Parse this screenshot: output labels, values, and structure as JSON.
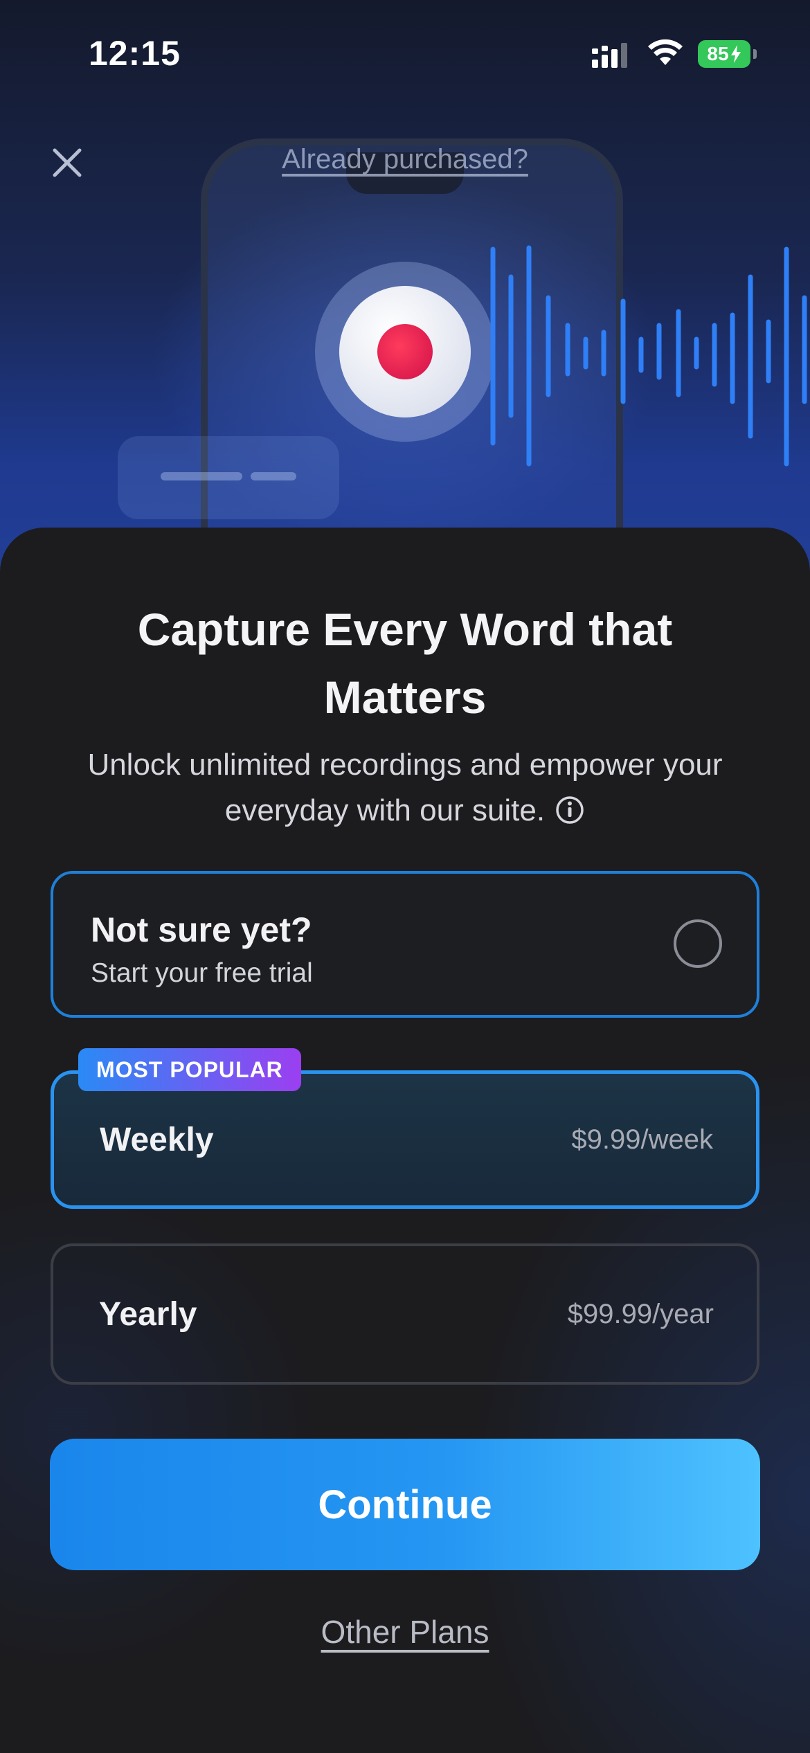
{
  "status_bar": {
    "time": "12:15",
    "battery": "85"
  },
  "header": {
    "already_purchased_label": "Already purchased?"
  },
  "headline": "Capture Every Word that Matters",
  "subtitle": "Unlock unlimited recordings and empower your everyday with our suite.",
  "plans": [
    {
      "title": "Not sure yet?",
      "subtitle": "Start your free trial",
      "selected": false
    },
    {
      "badge": "MOST POPULAR",
      "name": "Weekly",
      "price": "$9.99/week",
      "selected": true
    },
    {
      "name": "Yearly",
      "price": "$99.99/year",
      "selected": false
    }
  ],
  "continue_label": "Continue",
  "other_plans_label": "Other Plans",
  "colors": {
    "accent": "#2a93f0",
    "record": "#e0174f",
    "battery": "#34c759",
    "badge_start": "#2a8af5",
    "badge_end": "#9b3ff0"
  }
}
